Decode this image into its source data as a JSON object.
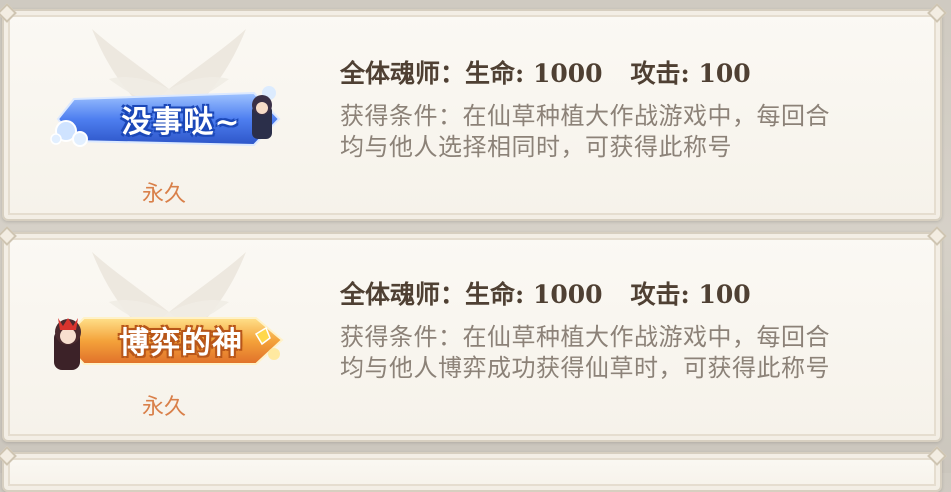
{
  "titles": [
    {
      "badge_label": "没事哒~",
      "duration": "永久",
      "stats": {
        "target": "全体魂师：",
        "hp": "生命: 1000",
        "atk": "攻击: 100"
      },
      "condition": "获得条件：在仙草种植大作战游戏中，每回合均与他人选择相同时，可获得此称号"
    },
    {
      "badge_label": "博弈的神",
      "duration": "永久",
      "stats": {
        "target": "全体魂师：",
        "hp": "生命: 1000",
        "atk": "攻击: 100"
      },
      "condition": "获得条件：在仙草种植大作战游戏中，每回合均与他人博弈成功获得仙草时，可获得此称号"
    }
  ],
  "colors": {
    "stat_text": "#4f4033",
    "desc_text": "#8c8278",
    "duration_text": "#d9804a",
    "badge_blue": "#3f6fe0",
    "badge_gold": "#f0a23c"
  }
}
